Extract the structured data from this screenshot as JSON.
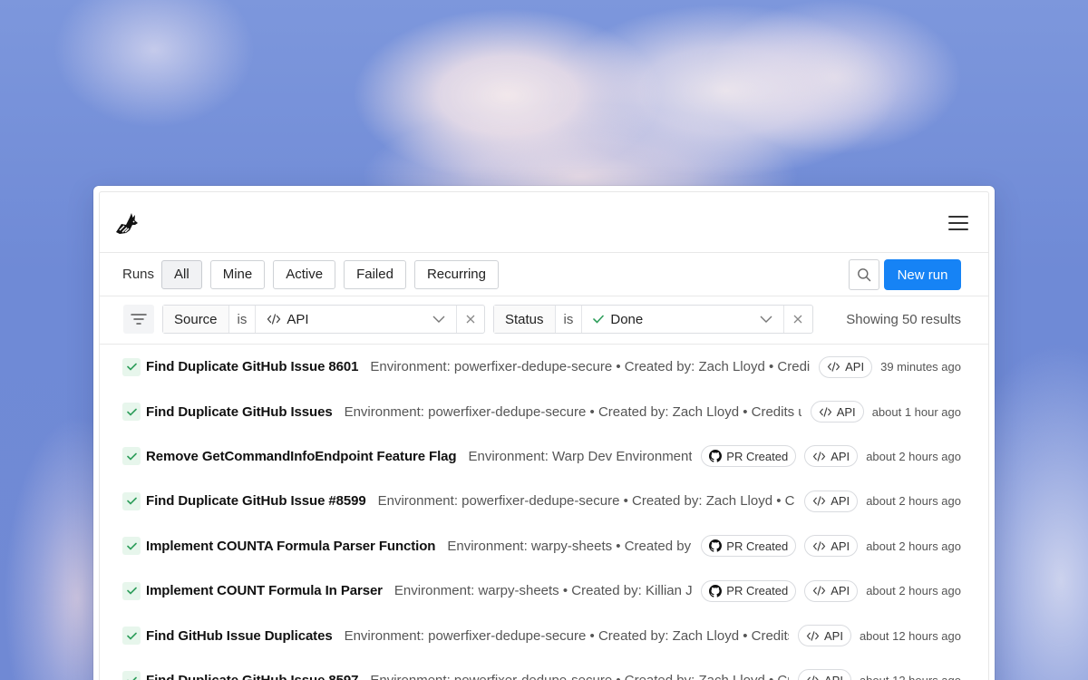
{
  "header": {
    "logo": "rabbit-logo-icon",
    "menu_icon": "hamburger-menu-icon"
  },
  "toolbar": {
    "runs_label": "Runs",
    "chips": [
      "All",
      "Mine",
      "Active",
      "Failed",
      "Recurring"
    ],
    "active_chip": "All",
    "search_icon": "search-icon",
    "new_run_label": "New run"
  },
  "filters": {
    "source": {
      "field": "Source",
      "op": "is",
      "value": "API",
      "icon": "code-icon"
    },
    "status": {
      "field": "Status",
      "op": "is",
      "value": "Done",
      "icon": "check-icon"
    },
    "showing": "Showing 50 results"
  },
  "rows": [
    {
      "title": "Find Duplicate GitHub Issue 8601",
      "desc": "Environment: powerfixer-dedupe-secure • Created by: Zach Lloyd • Credits used",
      "pr": "",
      "source": "API",
      "time": "39 minutes ago"
    },
    {
      "title": "Find Duplicate GitHub Issues",
      "desc": "Environment: powerfixer-dedupe-secure • Created by: Zach Lloyd • Credits used",
      "pr": "",
      "source": "API",
      "time": "about 1 hour ago"
    },
    {
      "title": "Remove GetCommandInfoEndpoint Feature Flag",
      "desc": "Environment: Warp Dev Environment • Created by",
      "pr": "PR Created",
      "source": "API",
      "time": "about 2 hours ago"
    },
    {
      "title": "Find Duplicate GitHub Issue #8599",
      "desc": "Environment: powerfixer-dedupe-secure • Created by: Zach Lloyd • Credits used",
      "pr": "",
      "source": "API",
      "time": "about 2 hours ago"
    },
    {
      "title": "Implement COUNTA Formula Parser Function",
      "desc": "Environment: warpy-sheets • Created by: Killian Jackson",
      "pr": "PR Created",
      "source": "API",
      "time": "about 2 hours ago"
    },
    {
      "title": "Implement COUNT Formula In Parser",
      "desc": "Environment: warpy-sheets • Created by: Killian Jackson",
      "pr": "PR Created",
      "source": "API",
      "time": "about 2 hours ago"
    },
    {
      "title": "Find GitHub Issue Duplicates",
      "desc": "Environment: powerfixer-dedupe-secure • Created by: Zach Lloyd • Credits used",
      "pr": "",
      "source": "API",
      "time": "about 12 hours ago"
    },
    {
      "title": "Find Duplicate GitHub Issue 8597",
      "desc": "Environment: powerfixer-dedupe-secure • Created by: Zach Lloyd • Credits used",
      "pr": "",
      "source": "API",
      "time": "about 12 hours ago"
    }
  ],
  "colors": {
    "accent": "#1683f5",
    "success": "#2e9e5b"
  }
}
